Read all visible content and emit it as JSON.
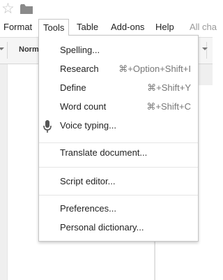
{
  "menubar": {
    "items": [
      "Format",
      "Tools",
      "Table",
      "Add-ons",
      "Help"
    ],
    "active": "Tools",
    "truncated": "All cha"
  },
  "toolbar": {
    "style_label": "Norm"
  },
  "tools_menu": {
    "spelling": "Spelling...",
    "research": {
      "label": "Research",
      "shortcut": "⌘+Option+Shift+I"
    },
    "define": {
      "label": "Define",
      "shortcut": "⌘+Shift+Y"
    },
    "word_count": {
      "label": "Word count",
      "shortcut": "⌘+Shift+C"
    },
    "voice_typing": "Voice typing...",
    "translate": "Translate document...",
    "script_editor": "Script editor...",
    "preferences": "Preferences...",
    "dictionary": "Personal dictionary..."
  },
  "icons": {
    "star": "star-icon",
    "folder": "folder-icon",
    "mic": "microphone-icon"
  },
  "colors": {
    "menu_border": "#c6c6c6",
    "shortcut_text": "#777777",
    "toolbar_bg": "#f5f5f5"
  }
}
